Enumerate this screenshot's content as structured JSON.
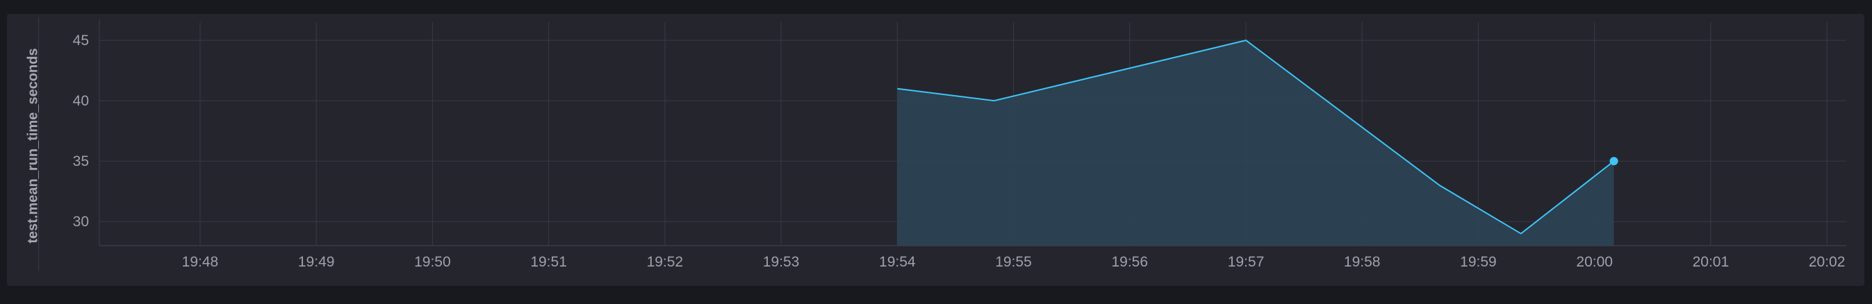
{
  "chart_data": {
    "type": "area",
    "ylabel": "test.mean_run_time_seconds",
    "x_ticks": [
      "19:48",
      "19:49",
      "19:50",
      "19:51",
      "19:52",
      "19:53",
      "19:54",
      "19:55",
      "19:56",
      "19:57",
      "19:58",
      "19:59",
      "20:00",
      "20:01",
      "20:02"
    ],
    "y_ticks": [
      30,
      35,
      40,
      45
    ],
    "ylim": [
      28,
      46.5
    ],
    "xlim": [
      "19:47:08",
      "20:02:10"
    ],
    "grid": true,
    "series": [
      {
        "color": "#3ec4f5",
        "points": [
          {
            "x": "19:54:00",
            "y": 41
          },
          {
            "x": "19:54:50",
            "y": 40
          },
          {
            "x": "19:57:00",
            "y": 45
          },
          {
            "x": "19:58:40",
            "y": 33
          },
          {
            "x": "19:59:22",
            "y": 29
          },
          {
            "x": "20:00:10",
            "y": 35
          }
        ]
      }
    ]
  },
  "colors": {
    "background": "#18181f",
    "panel": "#25252e",
    "grid": "#3a3a46",
    "line": "#3ec4f5",
    "fill": "#2d4556"
  }
}
